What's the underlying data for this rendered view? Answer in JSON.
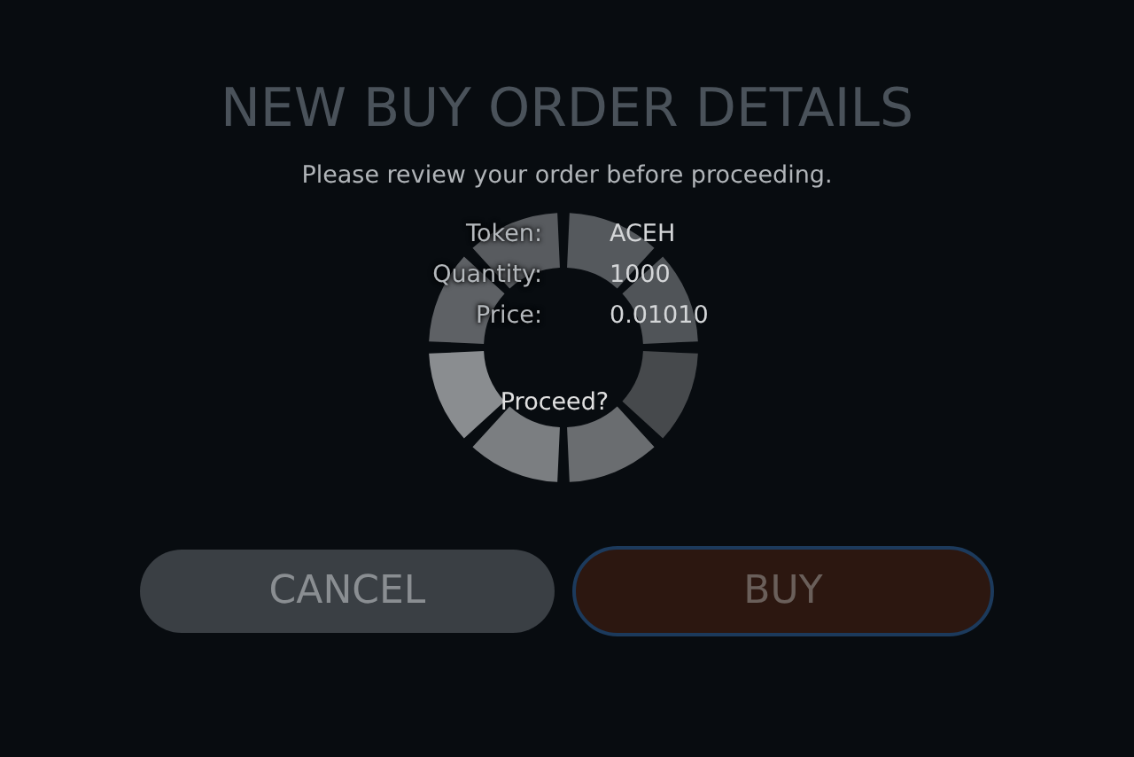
{
  "dialog": {
    "title": "NEW BUY ORDER DETAILS",
    "subtitle": "Please review your order before proceeding.",
    "details": [
      {
        "label": "Token:",
        "value": "ACEH"
      },
      {
        "label": "Quantity:",
        "value": "1000"
      },
      {
        "label": "Price:",
        "value": "0.01010"
      }
    ],
    "prompt": "Proceed?",
    "buttons": [
      {
        "kind": "cancel",
        "label": "CANCEL"
      },
      {
        "kind": "buy",
        "label": "BUY"
      }
    ]
  }
}
